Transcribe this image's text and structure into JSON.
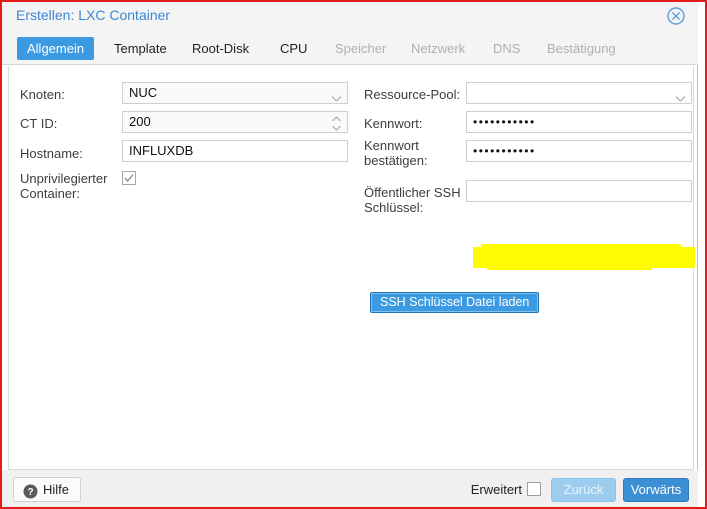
{
  "window": {
    "title": "Erstellen: LXC Container",
    "close_icon": "close-circle-icon",
    "accent": "#3c9ae2",
    "title_color": "#3c87d4",
    "annotation_frame_color": "#e31b1b"
  },
  "tabs": [
    {
      "label": "Allgemein",
      "state": "active"
    },
    {
      "label": "Template",
      "state": "enabled"
    },
    {
      "label": "Root-Disk",
      "state": "enabled"
    },
    {
      "label": "CPU",
      "state": "enabled"
    },
    {
      "label": "Speicher",
      "state": "disabled"
    },
    {
      "label": "Netzwerk",
      "state": "disabled"
    },
    {
      "label": "DNS",
      "state": "disabled"
    },
    {
      "label": "Bestätigung",
      "state": "disabled"
    }
  ],
  "form": {
    "left": {
      "node": {
        "label": "Knoten:",
        "value": "NUC",
        "icon": "chevron-down-icon"
      },
      "ctid": {
        "label": "CT ID:",
        "value": "200",
        "icon": "spinner-arrows-icon"
      },
      "hostname": {
        "label": "Hostname:",
        "value": "INFLUXDB",
        "placeholder": ""
      },
      "unprivileged": {
        "label_line1": "Unprivilegierter",
        "label_line2": "Container:",
        "checked": true
      }
    },
    "right": {
      "pool": {
        "label": "Ressource-Pool:",
        "value": "",
        "icon": "chevron-down-icon"
      },
      "password": {
        "label": "Kennwort:",
        "value": "•••••••••••"
      },
      "password_confirm": {
        "label_line1": "Kennwort",
        "label_line2": "bestätigen:",
        "value": "•••••••••••"
      },
      "ssh_key": {
        "label_line1": "Öffentlicher SSH",
        "label_line2": "Schlüssel:",
        "value": "",
        "redaction_color": "#fffb00"
      },
      "ssh_load_button": "SSH Schlüssel Datei laden"
    }
  },
  "footer": {
    "help_label": "Hilfe",
    "help_icon": "question-mark-circle-icon",
    "advanced_label": "Erweitert",
    "advanced_checked": false,
    "back_label": "Zurück",
    "back_disabled": true,
    "next_label": "Vorwärts"
  }
}
